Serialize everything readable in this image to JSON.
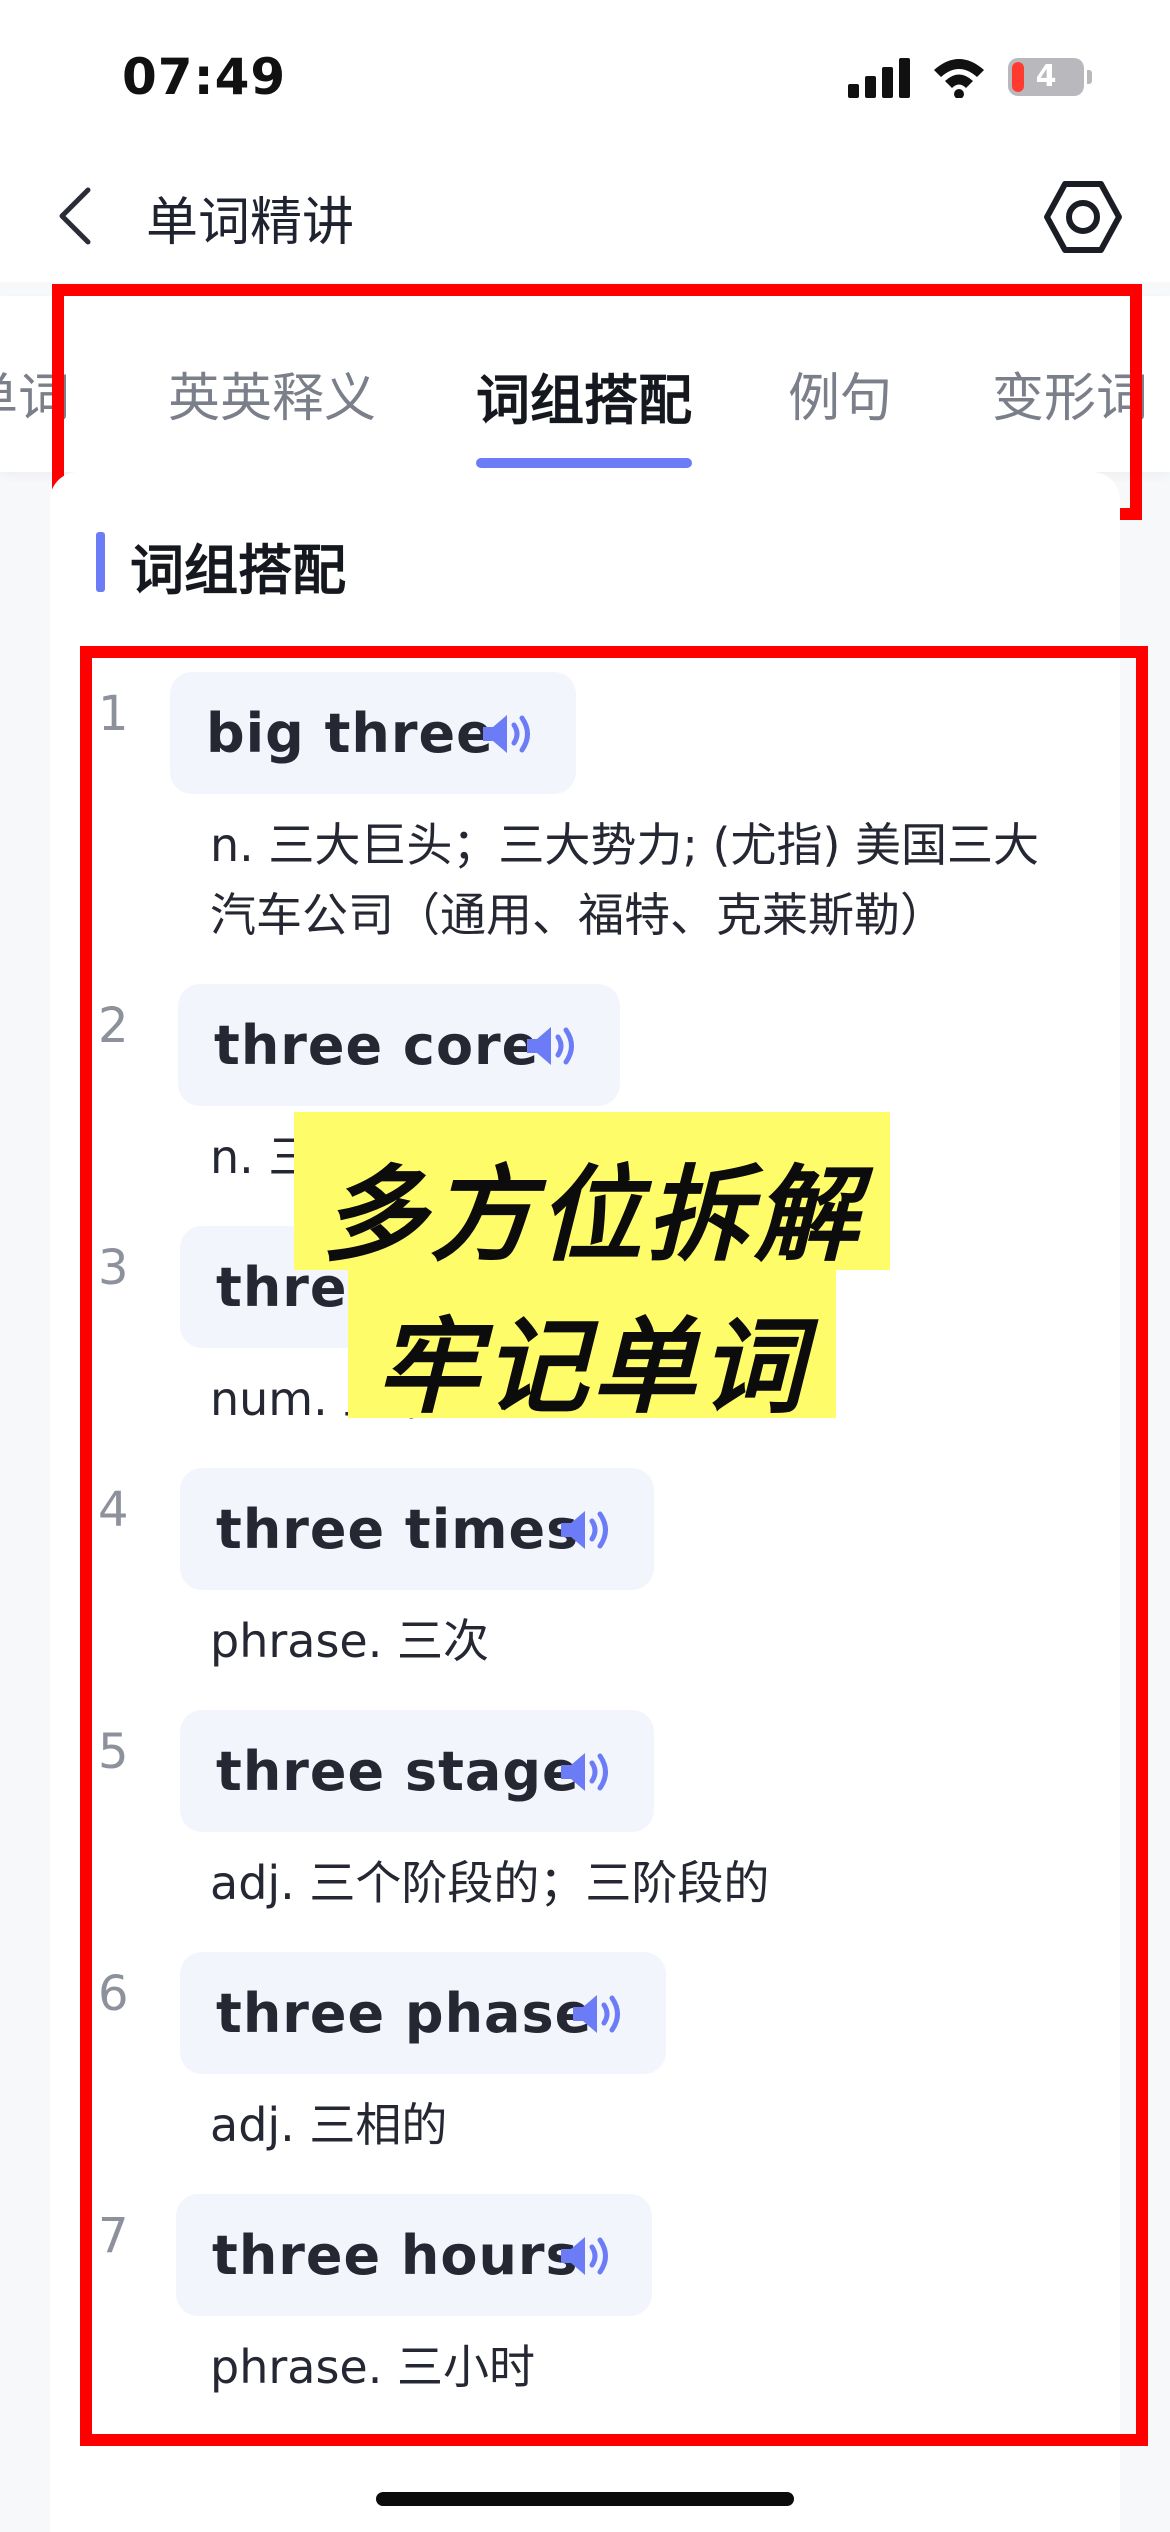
{
  "status_bar": {
    "time": "07:49",
    "battery": "4"
  },
  "nav": {
    "title": "单词精讲"
  },
  "tabs": [
    {
      "label": "单词"
    },
    {
      "label": "英英释义"
    },
    {
      "label": "词组搭配"
    },
    {
      "label": "例句"
    },
    {
      "label": "变形词"
    }
  ],
  "section": {
    "title": "词组搭配"
  },
  "phrases": [
    {
      "num": "1",
      "text": "big three",
      "definition": "n. 三大巨头；三大势力; (尤指) 美国三大汽车公司（通用、福特、克莱斯勒）"
    },
    {
      "num": "2",
      "text": "three core",
      "definition": "n. 三"
    },
    {
      "num": "3",
      "text": "three",
      "definition": "num. 三个"
    },
    {
      "num": "4",
      "text": "three times",
      "definition": "phrase. 三次"
    },
    {
      "num": "5",
      "text": "three stage",
      "definition": "adj. 三个阶段的；三阶段的"
    },
    {
      "num": "6",
      "text": "three phase",
      "definition": "adj. 三相的"
    },
    {
      "num": "7",
      "text": "three hours",
      "definition": "phrase. 三小时"
    }
  ],
  "overlay": {
    "line1": "多方位拆解",
    "line2": "牢记单词"
  },
  "colors": {
    "accent": "#6b7cf6",
    "highlight_border": "#ff0000",
    "banner": "#fffc6a"
  },
  "icons": {
    "back": "chevron-left-icon",
    "settings": "hexagon-settings-icon",
    "audio": "speaker-icon"
  }
}
